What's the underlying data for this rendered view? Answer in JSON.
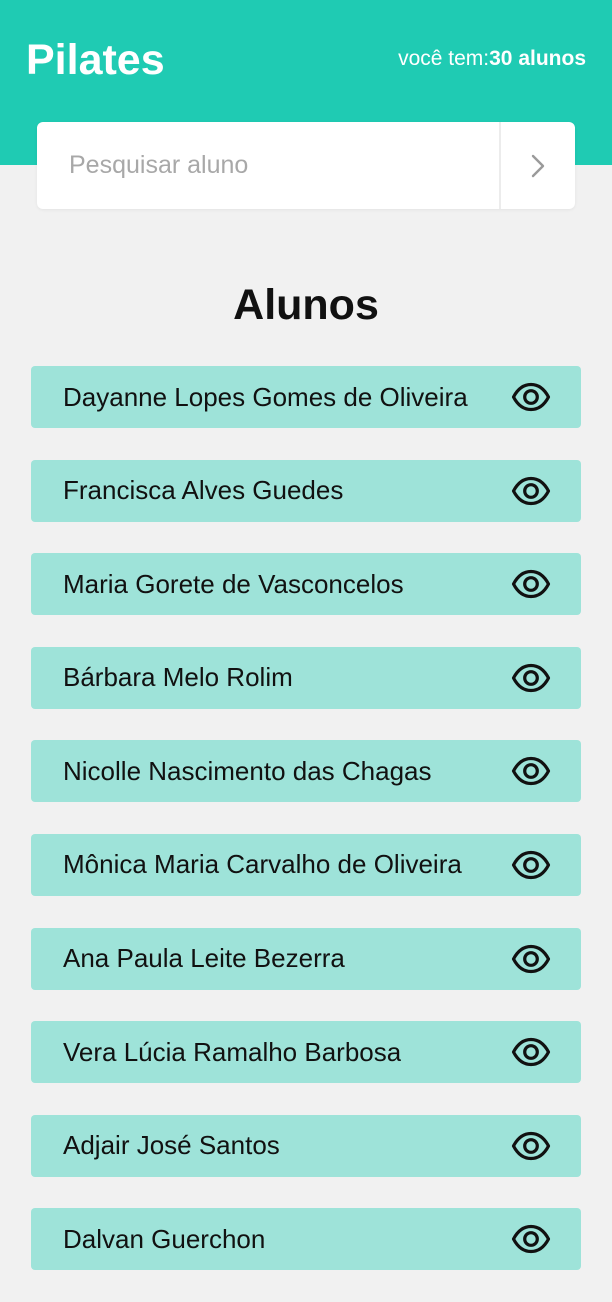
{
  "header": {
    "title": "Pilates",
    "count_prefix": "você tem:",
    "count_value": "30 alunos"
  },
  "search": {
    "placeholder": "Pesquisar aluno",
    "button_icon": "chevron-right-icon"
  },
  "section_title": "Alunos",
  "students": [
    {
      "name": "Dayanne Lopes Gomes de Oliveira",
      "icon": "eye-icon"
    },
    {
      "name": "Francisca Alves Guedes",
      "icon": "eye-icon"
    },
    {
      "name": "Maria Gorete de Vasconcelos",
      "icon": "eye-icon"
    },
    {
      "name": "Bárbara Melo Rolim",
      "icon": "eye-icon"
    },
    {
      "name": "Nicolle Nascimento das Chagas",
      "icon": "eye-icon"
    },
    {
      "name": "Mônica Maria Carvalho de Oliveira",
      "icon": "eye-icon"
    },
    {
      "name": "Ana Paula Leite Bezerra",
      "icon": "eye-icon"
    },
    {
      "name": "Vera Lúcia Ramalho Barbosa",
      "icon": "eye-icon"
    },
    {
      "name": "Adjair José Santos",
      "icon": "eye-icon"
    },
    {
      "name": "Dalvan Guerchon",
      "icon": "eye-icon"
    }
  ],
  "colors": {
    "header_bg": "#1fcbb3",
    "item_bg": "#9ee3d9",
    "page_bg": "#f1f1f1"
  }
}
